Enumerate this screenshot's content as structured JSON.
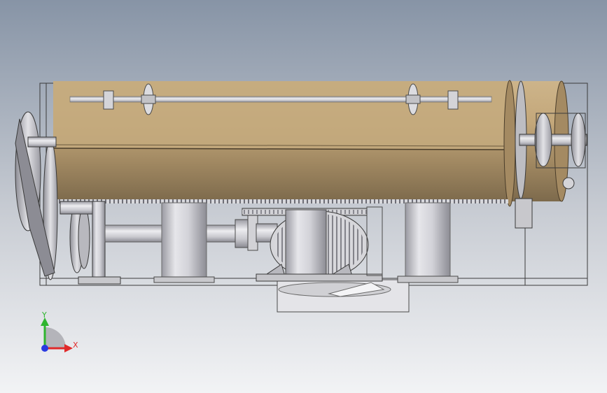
{
  "viewport": {
    "background_top": "#8a96a8",
    "background_bottom": "#f3f4f6"
  },
  "triad": {
    "y_label": "Y",
    "x_label": "X",
    "y_color": "#2fb52f",
    "x_color": "#e02a2a",
    "z_color": "#2a3ae0"
  },
  "colors": {
    "drum": "#b89a6c",
    "metal": "#c8c8cc",
    "frame_line": "#3a3a3a"
  }
}
